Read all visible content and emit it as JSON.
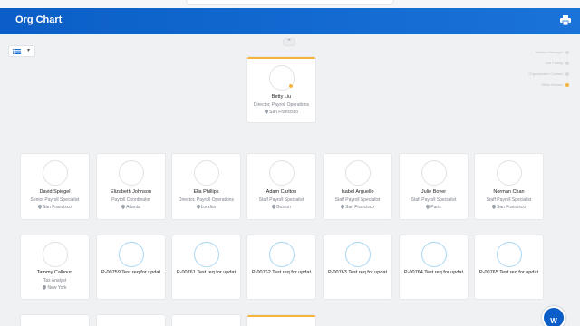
{
  "header": {
    "title": "Org Chart",
    "print_icon": "printer-icon"
  },
  "view_toggle": {
    "icon": "list-view-icon",
    "chevron": "chevron-down-icon",
    "chevron_glyph": "▾"
  },
  "collapse": {
    "glyph": "⌃"
  },
  "legend": [
    {
      "label": "Worker Manager",
      "active": false
    },
    {
      "label": "Job Family",
      "active": false
    },
    {
      "label": "Organization Contact",
      "active": false
    },
    {
      "label": "Other Worker",
      "active": true
    }
  ],
  "top": {
    "name": "Betty Liu",
    "role": "Director, Payroll Operations",
    "location": "San Francisco"
  },
  "row1": [
    {
      "name": "David Spiegel",
      "role": "Senior Payroll Specialist",
      "location": "San Francisco",
      "photo": "none"
    },
    {
      "name": "Elizabeth Johnson",
      "role": "Payroll Coordinator",
      "location": "Atlanta",
      "photo": "woman"
    },
    {
      "name": "Ella Phillips",
      "role": "Director, Payroll Operations",
      "location": "London",
      "photo": "none"
    },
    {
      "name": "Adam Carlton",
      "role": "Staff Payroll Specialist",
      "location": "Boston",
      "photo": "none"
    },
    {
      "name": "Isabel Arguello",
      "role": "Staff Payroll Specialist",
      "location": "San Francisco",
      "photo": "none"
    },
    {
      "name": "Julie Boyer",
      "role": "Staff Payroll Specialist",
      "location": "Paris",
      "photo": "man"
    },
    {
      "name": "Norman Chan",
      "role": "Staff Payroll Specialist",
      "location": "San Francisco",
      "photo": "none"
    }
  ],
  "row2": [
    {
      "name": "Tammy Calhoun",
      "role": "Tax Analyst",
      "location": "New York"
    },
    {
      "name": "P-00759 Test req for updat"
    },
    {
      "name": "P-00761 Test req for updat"
    },
    {
      "name": "P-00762 Test req for updat"
    },
    {
      "name": "P-00763 Test req for updat"
    },
    {
      "name": "P-00764 Test req for updat"
    },
    {
      "name": "P-00765 Test req for updat"
    }
  ],
  "help": {
    "label": "W"
  }
}
